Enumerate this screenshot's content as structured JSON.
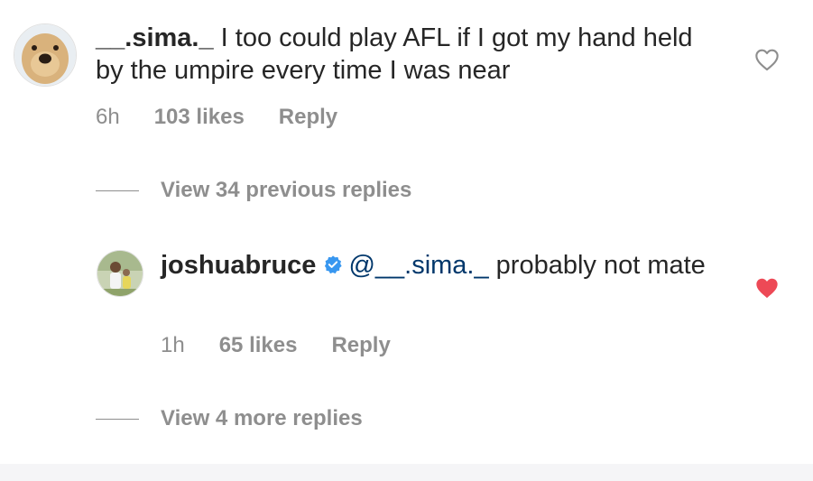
{
  "comment": {
    "username": "__.sima._",
    "text": "I too could play AFL if I got my hand held by the umpire every time I was near",
    "time": "6h",
    "likes": "103 likes",
    "reply_label": "Reply",
    "liked": false
  },
  "view_previous": {
    "label": "View 34 previous replies"
  },
  "reply": {
    "username": "joshuabruce",
    "verified": true,
    "mention": "@__.sima._",
    "text": " probably not mate",
    "time": "1h",
    "likes": "65 likes",
    "reply_label": "Reply",
    "liked": true
  },
  "view_more": {
    "label": "View 4 more replies"
  },
  "colors": {
    "heart_liked": "#ed4956",
    "verified_blue": "#3897f0",
    "mention": "#00376b",
    "muted": "#8e8e8e"
  },
  "icons": {
    "heart_outline": "heart-outline-icon",
    "heart_filled": "heart-filled-icon",
    "verified": "verified-badge-icon"
  }
}
